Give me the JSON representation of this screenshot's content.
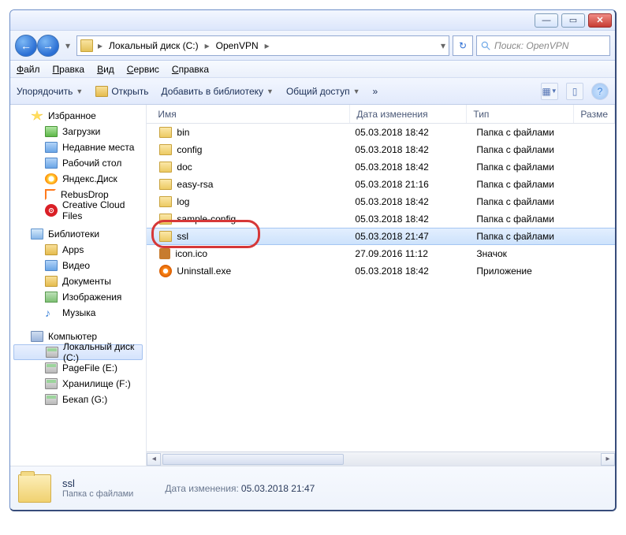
{
  "titlebar": {
    "min": "—",
    "max": "▭",
    "close": "✕"
  },
  "nav": {
    "back": "←",
    "forward": "→",
    "breadcrumb": [
      "Локальный диск (C:)",
      "OpenVPN"
    ],
    "search_placeholder": "Поиск: OpenVPN"
  },
  "menu": [
    "Файл",
    "Правка",
    "Вид",
    "Сервис",
    "Справка"
  ],
  "toolbar": {
    "organize": "Упорядочить",
    "open": "Открыть",
    "library": "Добавить в библиотеку",
    "share": "Общий доступ",
    "burn": "»"
  },
  "columns": {
    "name": "Имя",
    "date": "Дата изменения",
    "type": "Тип",
    "size": "Разме"
  },
  "sidebar": {
    "favorites": "Избранное",
    "fav_items": [
      "Загрузки",
      "Недавние места",
      "Рабочий стол",
      "Яндекс.Диск",
      "RebusDrop",
      "Creative Cloud Files"
    ],
    "libraries": "Библиотеки",
    "lib_items": [
      "Apps",
      "Видео",
      "Документы",
      "Изображения",
      "Музыка"
    ],
    "computer": "Компьютер",
    "drives": [
      "Локальный диск (C:)",
      "PageFile (E:)",
      "Хранилище (F:)",
      "Бекап (G:)"
    ]
  },
  "files": [
    {
      "name": "bin",
      "date": "05.03.2018 18:42",
      "type": "Папка с файлами",
      "icon": "folder"
    },
    {
      "name": "config",
      "date": "05.03.2018 18:42",
      "type": "Папка с файлами",
      "icon": "folder"
    },
    {
      "name": "doc",
      "date": "05.03.2018 18:42",
      "type": "Папка с файлами",
      "icon": "folder"
    },
    {
      "name": "easy-rsa",
      "date": "05.03.2018 21:16",
      "type": "Папка с файлами",
      "icon": "folder"
    },
    {
      "name": "log",
      "date": "05.03.2018 18:42",
      "type": "Папка с файлами",
      "icon": "folder"
    },
    {
      "name": "sample-config",
      "date": "05.03.2018 18:42",
      "type": "Папка с файлами",
      "icon": "folder"
    },
    {
      "name": "ssl",
      "date": "05.03.2018 21:47",
      "type": "Папка с файлами",
      "icon": "folder",
      "selected": true
    },
    {
      "name": "icon.ico",
      "date": "27.09.2016 11:12",
      "type": "Значок",
      "icon": "ico"
    },
    {
      "name": "Uninstall.exe",
      "date": "05.03.2018 18:42",
      "type": "Приложение",
      "icon": "ovpn"
    }
  ],
  "details": {
    "name": "ssl",
    "type": "Папка с файлами",
    "modified_label": "Дата изменения:",
    "modified": "05.03.2018 21:47"
  }
}
